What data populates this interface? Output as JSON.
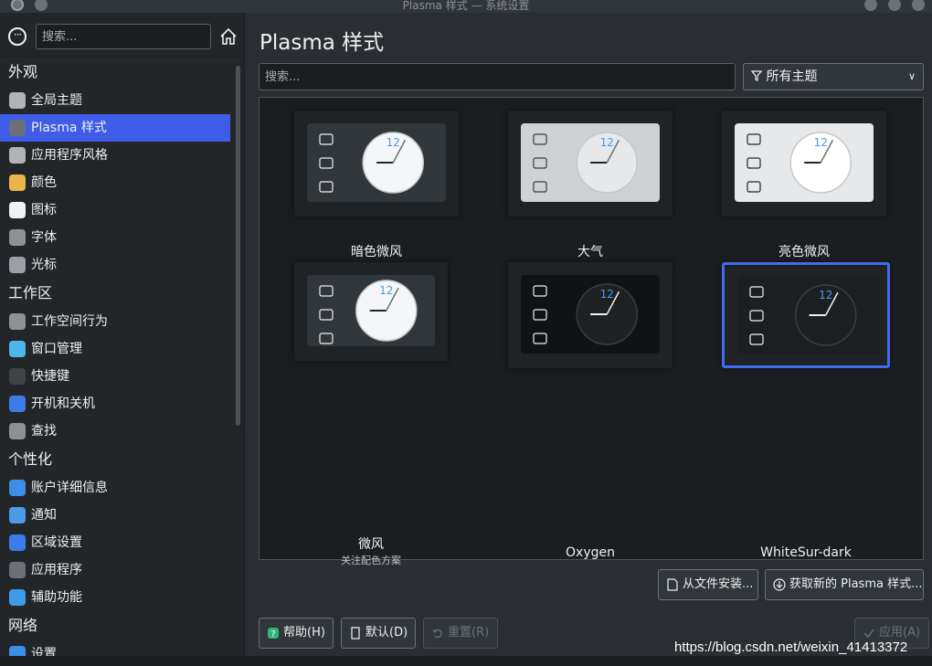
{
  "window": {
    "title": "Plasma 样式 — 系统设置"
  },
  "sidebar": {
    "search_placeholder": "搜索...",
    "sections": [
      {
        "label": "外观",
        "items": [
          {
            "label": "全局主题"
          },
          {
            "label": "Plasma 样式",
            "active": true
          },
          {
            "label": "应用程序风格"
          },
          {
            "label": "颜色"
          },
          {
            "label": "图标"
          },
          {
            "label": "字体"
          },
          {
            "label": "光标"
          }
        ]
      },
      {
        "label": "工作区",
        "items": [
          {
            "label": "工作空间行为"
          },
          {
            "label": "窗口管理"
          },
          {
            "label": "快捷键"
          },
          {
            "label": "开机和关机"
          },
          {
            "label": "查找"
          }
        ]
      },
      {
        "label": "个性化",
        "items": [
          {
            "label": "账户详细信息"
          },
          {
            "label": "通知"
          },
          {
            "label": "区域设置"
          },
          {
            "label": "应用程序"
          },
          {
            "label": "辅助功能"
          }
        ]
      },
      {
        "label": "网络",
        "items": [
          {
            "label": "设置"
          }
        ]
      }
    ]
  },
  "main": {
    "title": "Plasma 样式",
    "search_placeholder": "搜索...",
    "filter": {
      "selected": "所有主题"
    },
    "themes": [
      {
        "name": "暗色微风",
        "subtitle": "",
        "style": "breeze-dark"
      },
      {
        "name": "大气",
        "subtitle": "",
        "style": "air"
      },
      {
        "name": "亮色微风",
        "subtitle": "",
        "style": "breeze-light"
      },
      {
        "name": "微风",
        "subtitle": "关注配色方案",
        "style": "breeze"
      },
      {
        "name": "Oxygen",
        "subtitle": "",
        "style": "oxygen"
      },
      {
        "name": "WhiteSur-dark",
        "subtitle": "",
        "style": "whitesur",
        "selected": true
      }
    ],
    "clock_number": "12",
    "install_from_file": "从文件安装...",
    "get_new": "获取新的 Plasma 样式...",
    "help": "帮助(H)",
    "defaults": "默认(D)",
    "reset": "重置(R)",
    "apply": "应用(A)"
  },
  "watermark": "https://blog.csdn.net/weixin_41413372",
  "colors": {
    "accent": "#3d5ce8",
    "selection_border": "#3d6cf4"
  }
}
